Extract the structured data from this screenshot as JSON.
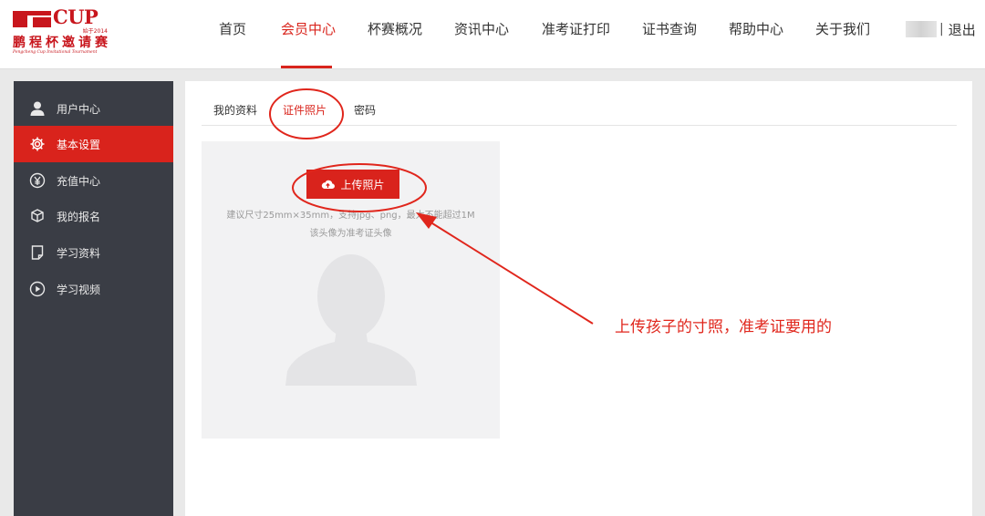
{
  "brand": {
    "mark": "CUP",
    "since": "始于2014",
    "name": "鹏程杯邀请赛",
    "english": "Pengcheng Cup Invitational Tournament",
    "color": "#c8161d"
  },
  "nav": {
    "items": [
      {
        "label": "首页",
        "active": false
      },
      {
        "label": "会员中心",
        "active": true
      },
      {
        "label": "杯赛概况",
        "active": false
      },
      {
        "label": "资讯中心",
        "active": false
      },
      {
        "label": "准考证打印",
        "active": false
      },
      {
        "label": "证书查询",
        "active": false
      },
      {
        "label": "帮助中心",
        "active": false
      },
      {
        "label": "关于我们",
        "active": false
      }
    ],
    "separator": "|",
    "logout": "退出",
    "accent": "#d9251d"
  },
  "sidebar": {
    "items": [
      {
        "label": "用户中心",
        "icon": "user-icon",
        "active": false
      },
      {
        "label": "基本设置",
        "icon": "gear-icon",
        "active": true
      },
      {
        "label": "充值中心",
        "icon": "yen-icon",
        "active": false
      },
      {
        "label": "我的报名",
        "icon": "box-icon",
        "active": false
      },
      {
        "label": "学习资料",
        "icon": "document-icon",
        "active": false
      },
      {
        "label": "学习视频",
        "icon": "play-icon",
        "active": false
      }
    ]
  },
  "tabs": [
    {
      "label": "我的资料",
      "active": false
    },
    {
      "label": "证件照片",
      "active": true
    },
    {
      "label": "密码",
      "active": false
    }
  ],
  "photo": {
    "upload_label": "上传照片",
    "hint_size": "建议尺寸25mm×35mm，支持jpg、png，最大不能超过1M",
    "hint_usage": "该头像为准考证头像"
  },
  "annotation": {
    "text": "上传孩子的寸照，准考证要用的",
    "color": "#e0261c"
  }
}
